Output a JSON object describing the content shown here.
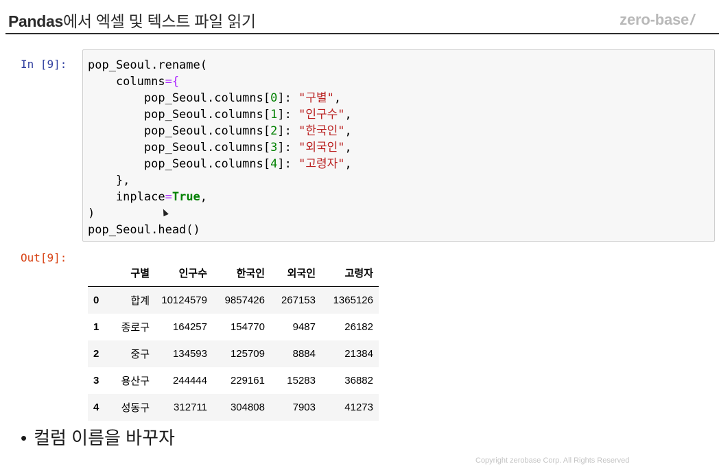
{
  "header": {
    "title_bold": "Pandas",
    "title_rest": "에서 엑셀 및 텍스트 파일 읽기",
    "logo": "zero-base",
    "logo_mark": "/"
  },
  "notebook": {
    "in_prompt": "In [9]:",
    "out_prompt": "Out[9]:",
    "code_lines": [
      [
        {
          "t": "pop_Seoul.rename(",
          "c": ""
        }
      ],
      [
        {
          "t": "    columns",
          "c": ""
        },
        {
          "t": "={",
          "c": "o"
        }
      ],
      [
        {
          "t": "        pop_Seoul.columns[",
          "c": ""
        },
        {
          "t": "0",
          "c": "n"
        },
        {
          "t": "]: ",
          "c": ""
        },
        {
          "t": "\"구별\"",
          "c": "s"
        },
        {
          "t": ",",
          "c": ""
        }
      ],
      [
        {
          "t": "        pop_Seoul.columns[",
          "c": ""
        },
        {
          "t": "1",
          "c": "n"
        },
        {
          "t": "]: ",
          "c": ""
        },
        {
          "t": "\"인구수\"",
          "c": "s"
        },
        {
          "t": ",",
          "c": ""
        }
      ],
      [
        {
          "t": "        pop_Seoul.columns[",
          "c": ""
        },
        {
          "t": "2",
          "c": "n"
        },
        {
          "t": "]: ",
          "c": ""
        },
        {
          "t": "\"한국인\"",
          "c": "s"
        },
        {
          "t": ",",
          "c": ""
        }
      ],
      [
        {
          "t": "        pop_Seoul.columns[",
          "c": ""
        },
        {
          "t": "3",
          "c": "n"
        },
        {
          "t": "]: ",
          "c": ""
        },
        {
          "t": "\"외국인\"",
          "c": "s"
        },
        {
          "t": ",",
          "c": ""
        }
      ],
      [
        {
          "t": "        pop_Seoul.columns[",
          "c": ""
        },
        {
          "t": "4",
          "c": "n"
        },
        {
          "t": "]: ",
          "c": ""
        },
        {
          "t": "\"고령자\"",
          "c": "s"
        },
        {
          "t": ",",
          "c": ""
        }
      ],
      [
        {
          "t": "    },",
          "c": ""
        }
      ],
      [
        {
          "t": "    inplace",
          "c": ""
        },
        {
          "t": "=",
          "c": "o"
        },
        {
          "t": "True",
          "c": "k"
        },
        {
          "t": ",",
          "c": ""
        }
      ],
      [
        {
          "t": ")",
          "c": ""
        }
      ],
      [
        {
          "t": "pop_Seoul.head()",
          "c": ""
        }
      ]
    ]
  },
  "dataframe": {
    "columns": [
      "",
      "구별",
      "인구수",
      "한국인",
      "외국인",
      "고령자"
    ],
    "rows": [
      [
        "0",
        "합계",
        "10124579",
        "9857426",
        "267153",
        "1365126"
      ],
      [
        "1",
        "종로구",
        "164257",
        "154770",
        "9487",
        "26182"
      ],
      [
        "2",
        "중구",
        "134593",
        "125709",
        "8884",
        "21384"
      ],
      [
        "3",
        "용산구",
        "244444",
        "229161",
        "15283",
        "36882"
      ],
      [
        "4",
        "성동구",
        "312711",
        "304808",
        "7903",
        "41273"
      ]
    ]
  },
  "bullet": "컬럼 이름을 바꾸자",
  "bullet_mark": "•",
  "footer": {
    "copyright": "Copyright zerobase Corp. All Rights Reserved"
  },
  "colors": {
    "prompt_in": "#303f9f",
    "prompt_out": "#d84315",
    "string": "#ba2121",
    "keyword": "#008000",
    "operator": "#aa22ff"
  }
}
